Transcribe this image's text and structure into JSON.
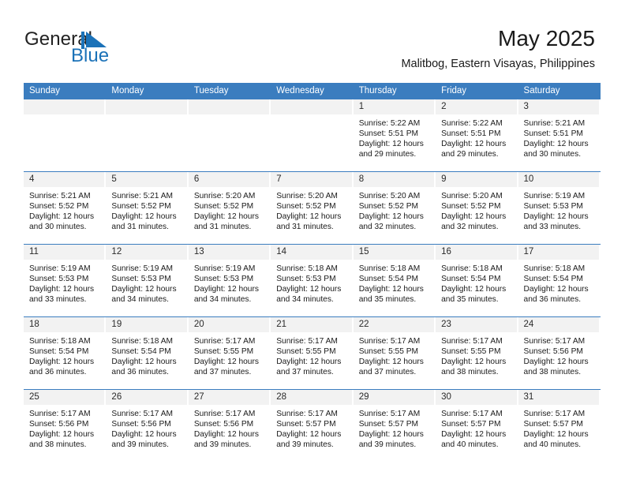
{
  "brand": {
    "name_part1": "General",
    "name_part2": "Blue",
    "logo_color": "#1b72b8"
  },
  "header": {
    "title": "May 2025",
    "subtitle": "Malitbog, Eastern Visayas, Philippines"
  },
  "theme": {
    "header_blue": "#3b7dbf",
    "day_strip_gray": "#f2f2f2",
    "text": "#1a1a1a"
  },
  "calendar": {
    "weekday_headers": [
      "Sunday",
      "Monday",
      "Tuesday",
      "Wednesday",
      "Thursday",
      "Friday",
      "Saturday"
    ],
    "weeks": [
      [
        {
          "day": "",
          "empty": true,
          "sunrise": "",
          "sunset": "",
          "daylight_line1": "",
          "daylight_line2": ""
        },
        {
          "day": "",
          "empty": true,
          "sunrise": "",
          "sunset": "",
          "daylight_line1": "",
          "daylight_line2": ""
        },
        {
          "day": "",
          "empty": true,
          "sunrise": "",
          "sunset": "",
          "daylight_line1": "",
          "daylight_line2": ""
        },
        {
          "day": "",
          "empty": true,
          "sunrise": "",
          "sunset": "",
          "daylight_line1": "",
          "daylight_line2": ""
        },
        {
          "day": "1",
          "empty": false,
          "sunrise": "Sunrise: 5:22 AM",
          "sunset": "Sunset: 5:51 PM",
          "daylight_line1": "Daylight: 12 hours",
          "daylight_line2": "and 29 minutes."
        },
        {
          "day": "2",
          "empty": false,
          "sunrise": "Sunrise: 5:22 AM",
          "sunset": "Sunset: 5:51 PM",
          "daylight_line1": "Daylight: 12 hours",
          "daylight_line2": "and 29 minutes."
        },
        {
          "day": "3",
          "empty": false,
          "sunrise": "Sunrise: 5:21 AM",
          "sunset": "Sunset: 5:51 PM",
          "daylight_line1": "Daylight: 12 hours",
          "daylight_line2": "and 30 minutes."
        }
      ],
      [
        {
          "day": "4",
          "empty": false,
          "sunrise": "Sunrise: 5:21 AM",
          "sunset": "Sunset: 5:52 PM",
          "daylight_line1": "Daylight: 12 hours",
          "daylight_line2": "and 30 minutes."
        },
        {
          "day": "5",
          "empty": false,
          "sunrise": "Sunrise: 5:21 AM",
          "sunset": "Sunset: 5:52 PM",
          "daylight_line1": "Daylight: 12 hours",
          "daylight_line2": "and 31 minutes."
        },
        {
          "day": "6",
          "empty": false,
          "sunrise": "Sunrise: 5:20 AM",
          "sunset": "Sunset: 5:52 PM",
          "daylight_line1": "Daylight: 12 hours",
          "daylight_line2": "and 31 minutes."
        },
        {
          "day": "7",
          "empty": false,
          "sunrise": "Sunrise: 5:20 AM",
          "sunset": "Sunset: 5:52 PM",
          "daylight_line1": "Daylight: 12 hours",
          "daylight_line2": "and 31 minutes."
        },
        {
          "day": "8",
          "empty": false,
          "sunrise": "Sunrise: 5:20 AM",
          "sunset": "Sunset: 5:52 PM",
          "daylight_line1": "Daylight: 12 hours",
          "daylight_line2": "and 32 minutes."
        },
        {
          "day": "9",
          "empty": false,
          "sunrise": "Sunrise: 5:20 AM",
          "sunset": "Sunset: 5:52 PM",
          "daylight_line1": "Daylight: 12 hours",
          "daylight_line2": "and 32 minutes."
        },
        {
          "day": "10",
          "empty": false,
          "sunrise": "Sunrise: 5:19 AM",
          "sunset": "Sunset: 5:53 PM",
          "daylight_line1": "Daylight: 12 hours",
          "daylight_line2": "and 33 minutes."
        }
      ],
      [
        {
          "day": "11",
          "empty": false,
          "sunrise": "Sunrise: 5:19 AM",
          "sunset": "Sunset: 5:53 PM",
          "daylight_line1": "Daylight: 12 hours",
          "daylight_line2": "and 33 minutes."
        },
        {
          "day": "12",
          "empty": false,
          "sunrise": "Sunrise: 5:19 AM",
          "sunset": "Sunset: 5:53 PM",
          "daylight_line1": "Daylight: 12 hours",
          "daylight_line2": "and 34 minutes."
        },
        {
          "day": "13",
          "empty": false,
          "sunrise": "Sunrise: 5:19 AM",
          "sunset": "Sunset: 5:53 PM",
          "daylight_line1": "Daylight: 12 hours",
          "daylight_line2": "and 34 minutes."
        },
        {
          "day": "14",
          "empty": false,
          "sunrise": "Sunrise: 5:18 AM",
          "sunset": "Sunset: 5:53 PM",
          "daylight_line1": "Daylight: 12 hours",
          "daylight_line2": "and 34 minutes."
        },
        {
          "day": "15",
          "empty": false,
          "sunrise": "Sunrise: 5:18 AM",
          "sunset": "Sunset: 5:54 PM",
          "daylight_line1": "Daylight: 12 hours",
          "daylight_line2": "and 35 minutes."
        },
        {
          "day": "16",
          "empty": false,
          "sunrise": "Sunrise: 5:18 AM",
          "sunset": "Sunset: 5:54 PM",
          "daylight_line1": "Daylight: 12 hours",
          "daylight_line2": "and 35 minutes."
        },
        {
          "day": "17",
          "empty": false,
          "sunrise": "Sunrise: 5:18 AM",
          "sunset": "Sunset: 5:54 PM",
          "daylight_line1": "Daylight: 12 hours",
          "daylight_line2": "and 36 minutes."
        }
      ],
      [
        {
          "day": "18",
          "empty": false,
          "sunrise": "Sunrise: 5:18 AM",
          "sunset": "Sunset: 5:54 PM",
          "daylight_line1": "Daylight: 12 hours",
          "daylight_line2": "and 36 minutes."
        },
        {
          "day": "19",
          "empty": false,
          "sunrise": "Sunrise: 5:18 AM",
          "sunset": "Sunset: 5:54 PM",
          "daylight_line1": "Daylight: 12 hours",
          "daylight_line2": "and 36 minutes."
        },
        {
          "day": "20",
          "empty": false,
          "sunrise": "Sunrise: 5:17 AM",
          "sunset": "Sunset: 5:55 PM",
          "daylight_line1": "Daylight: 12 hours",
          "daylight_line2": "and 37 minutes."
        },
        {
          "day": "21",
          "empty": false,
          "sunrise": "Sunrise: 5:17 AM",
          "sunset": "Sunset: 5:55 PM",
          "daylight_line1": "Daylight: 12 hours",
          "daylight_line2": "and 37 minutes."
        },
        {
          "day": "22",
          "empty": false,
          "sunrise": "Sunrise: 5:17 AM",
          "sunset": "Sunset: 5:55 PM",
          "daylight_line1": "Daylight: 12 hours",
          "daylight_line2": "and 37 minutes."
        },
        {
          "day": "23",
          "empty": false,
          "sunrise": "Sunrise: 5:17 AM",
          "sunset": "Sunset: 5:55 PM",
          "daylight_line1": "Daylight: 12 hours",
          "daylight_line2": "and 38 minutes."
        },
        {
          "day": "24",
          "empty": false,
          "sunrise": "Sunrise: 5:17 AM",
          "sunset": "Sunset: 5:56 PM",
          "daylight_line1": "Daylight: 12 hours",
          "daylight_line2": "and 38 minutes."
        }
      ],
      [
        {
          "day": "25",
          "empty": false,
          "sunrise": "Sunrise: 5:17 AM",
          "sunset": "Sunset: 5:56 PM",
          "daylight_line1": "Daylight: 12 hours",
          "daylight_line2": "and 38 minutes."
        },
        {
          "day": "26",
          "empty": false,
          "sunrise": "Sunrise: 5:17 AM",
          "sunset": "Sunset: 5:56 PM",
          "daylight_line1": "Daylight: 12 hours",
          "daylight_line2": "and 39 minutes."
        },
        {
          "day": "27",
          "empty": false,
          "sunrise": "Sunrise: 5:17 AM",
          "sunset": "Sunset: 5:56 PM",
          "daylight_line1": "Daylight: 12 hours",
          "daylight_line2": "and 39 minutes."
        },
        {
          "day": "28",
          "empty": false,
          "sunrise": "Sunrise: 5:17 AM",
          "sunset": "Sunset: 5:57 PM",
          "daylight_line1": "Daylight: 12 hours",
          "daylight_line2": "and 39 minutes."
        },
        {
          "day": "29",
          "empty": false,
          "sunrise": "Sunrise: 5:17 AM",
          "sunset": "Sunset: 5:57 PM",
          "daylight_line1": "Daylight: 12 hours",
          "daylight_line2": "and 39 minutes."
        },
        {
          "day": "30",
          "empty": false,
          "sunrise": "Sunrise: 5:17 AM",
          "sunset": "Sunset: 5:57 PM",
          "daylight_line1": "Daylight: 12 hours",
          "daylight_line2": "and 40 minutes."
        },
        {
          "day": "31",
          "empty": false,
          "sunrise": "Sunrise: 5:17 AM",
          "sunset": "Sunset: 5:57 PM",
          "daylight_line1": "Daylight: 12 hours",
          "daylight_line2": "and 40 minutes."
        }
      ]
    ]
  }
}
